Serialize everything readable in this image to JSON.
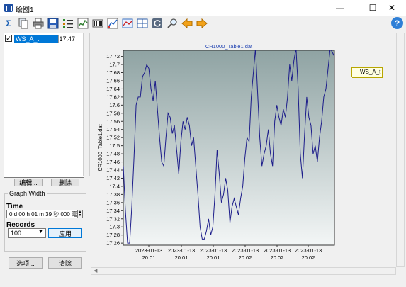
{
  "window": {
    "title": "绘图1",
    "minimize": "—",
    "maximize": "☐",
    "close": "✕",
    "help": "?"
  },
  "toolbar": {
    "items": [
      {
        "icon": "sigma-icon",
        "glyph": "Σ"
      },
      {
        "icon": "copy-icon"
      },
      {
        "icon": "print-icon"
      },
      {
        "icon": "save-icon"
      },
      {
        "icon": "list-icon"
      },
      {
        "icon": "line-chart-icon"
      },
      {
        "icon": "barcode-icon"
      },
      {
        "icon": "chart-edit-icon"
      },
      {
        "icon": "trend-chart-icon"
      },
      {
        "icon": "table-grid-icon"
      },
      {
        "icon": "refresh-icon"
      },
      {
        "icon": "zoom-icon"
      },
      {
        "icon": "arrow-left-icon"
      },
      {
        "icon": "arrow-right-icon"
      }
    ]
  },
  "series_list": {
    "items": [
      {
        "name": "WS_A_t",
        "value": "17.47",
        "checked": true
      }
    ]
  },
  "buttons": {
    "edit": "编辑...",
    "delete": "删除",
    "options": "选项...",
    "clear": "清除",
    "apply": "应用"
  },
  "graph_width": {
    "legend": "Graph Width",
    "time_label": "Time",
    "time_value": "0 d 00 h 01 m 39 秒 000 毫",
    "records_label": "Records",
    "records_value": "100"
  },
  "chart_data": {
    "type": "line",
    "title": "CR1000_Table1.dat",
    "ylabel": "CR1000_Table1.dat",
    "xlabel": "",
    "ylim": [
      17.255,
      17.735
    ],
    "yticks": [
      "17.72",
      "17.7",
      "17.68",
      "17.66",
      "17.64",
      "17.62",
      "17.6",
      "17.58",
      "17.56",
      "17.54",
      "17.52",
      "17.5",
      "17.48",
      "17.46",
      "17.44",
      "17.42",
      "17.4",
      "17.38",
      "17.36",
      "17.34",
      "17.32",
      "17.3",
      "17.28",
      "17.26"
    ],
    "xtick_labels": [
      {
        "date": "2023-01-13",
        "time": "20:01"
      },
      {
        "date": "2023-01-13",
        "time": "20:01"
      },
      {
        "date": "2023-01-13",
        "time": "20:01"
      },
      {
        "date": "2023-01-13",
        "time": "20:02"
      },
      {
        "date": "2023-01-13",
        "time": "20:02"
      },
      {
        "date": "2023-01-13",
        "time": "20:02"
      }
    ],
    "grid": false,
    "legend_position": "right",
    "series": [
      {
        "name": "WS_A_t",
        "color": "#1c1c8a",
        "values": [
          17.45,
          17.34,
          17.26,
          17.26,
          17.35,
          17.47,
          17.6,
          17.62,
          17.62,
          17.67,
          17.68,
          17.7,
          17.69,
          17.64,
          17.61,
          17.66,
          17.59,
          17.52,
          17.46,
          17.45,
          17.52,
          17.58,
          17.57,
          17.53,
          17.55,
          17.49,
          17.43,
          17.51,
          17.56,
          17.54,
          17.57,
          17.55,
          17.5,
          17.52,
          17.45,
          17.38,
          17.3,
          17.27,
          17.27,
          17.29,
          17.32,
          17.28,
          17.3,
          17.38,
          17.49,
          17.43,
          17.36,
          17.38,
          17.42,
          17.39,
          17.31,
          17.35,
          17.37,
          17.35,
          17.33,
          17.37,
          17.4,
          17.47,
          17.52,
          17.51,
          17.62,
          17.68,
          17.74,
          17.63,
          17.52,
          17.45,
          17.48,
          17.5,
          17.54,
          17.48,
          17.45,
          17.56,
          17.6,
          17.57,
          17.55,
          17.59,
          17.57,
          17.62,
          17.7,
          17.66,
          17.71,
          17.74,
          17.64,
          17.48,
          17.42,
          17.53,
          17.62,
          17.57,
          17.55,
          17.48,
          17.5,
          17.46,
          17.52,
          17.56,
          17.62,
          17.64,
          17.69,
          17.74,
          17.73,
          17.72
        ]
      }
    ]
  }
}
